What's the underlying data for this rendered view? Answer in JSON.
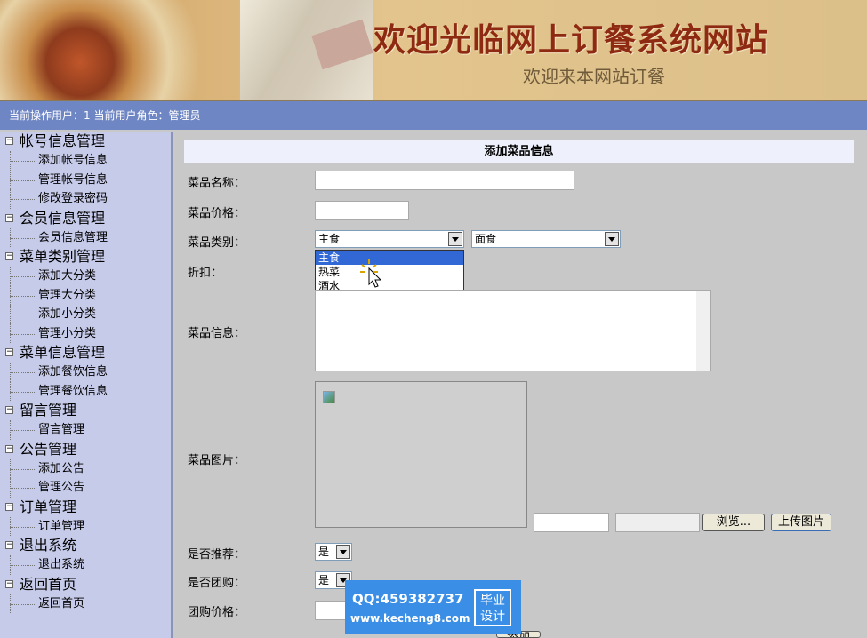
{
  "banner": {
    "title": "欢迎光临网上订餐系统网站",
    "subtitle": "欢迎来本网站订餐"
  },
  "status": {
    "text": "当前操作用户：1 当前用户角色：管理员"
  },
  "sidebar": {
    "groups": [
      {
        "label": "帐号信息管理",
        "items": [
          "添加帐号信息",
          "管理帐号信息",
          "修改登录密码"
        ]
      },
      {
        "label": "会员信息管理",
        "items": [
          "会员信息管理"
        ]
      },
      {
        "label": "菜单类别管理",
        "items": [
          "添加大分类",
          "管理大分类",
          "添加小分类",
          "管理小分类"
        ]
      },
      {
        "label": "菜单信息管理",
        "items": [
          "添加餐饮信息",
          "管理餐饮信息"
        ]
      },
      {
        "label": "留言管理",
        "items": [
          "留言管理"
        ]
      },
      {
        "label": "公告管理",
        "items": [
          "添加公告",
          "管理公告"
        ]
      },
      {
        "label": "订单管理",
        "items": [
          "订单管理"
        ]
      },
      {
        "label": "退出系统",
        "items": [
          "退出系统"
        ]
      },
      {
        "label": "返回首页",
        "items": [
          "返回首页"
        ]
      }
    ]
  },
  "form": {
    "header": "添加菜品信息",
    "name_label": "菜品名称：",
    "price_label": "菜品价格：",
    "category_label": "菜品类别：",
    "category_value": "主食",
    "subcategory_value": "面食",
    "category_options": [
      "主食",
      "热菜",
      "酒水"
    ],
    "discount_label": "折扣：",
    "info_label": "菜品信息：",
    "image_label": "菜品图片：",
    "browse_button": "浏览...",
    "upload_button": "上传图片",
    "recommend_label": "是否推荐：",
    "recommend_value": "是",
    "group_buy_label": "是否团购：",
    "group_buy_value": "是",
    "group_price_label": "团购价格：",
    "submit_button": "添加"
  },
  "watermark": {
    "qq": "QQ:459382737",
    "url": "www.kecheng8.com",
    "badge_line1": "毕业",
    "badge_line2": "设计"
  }
}
